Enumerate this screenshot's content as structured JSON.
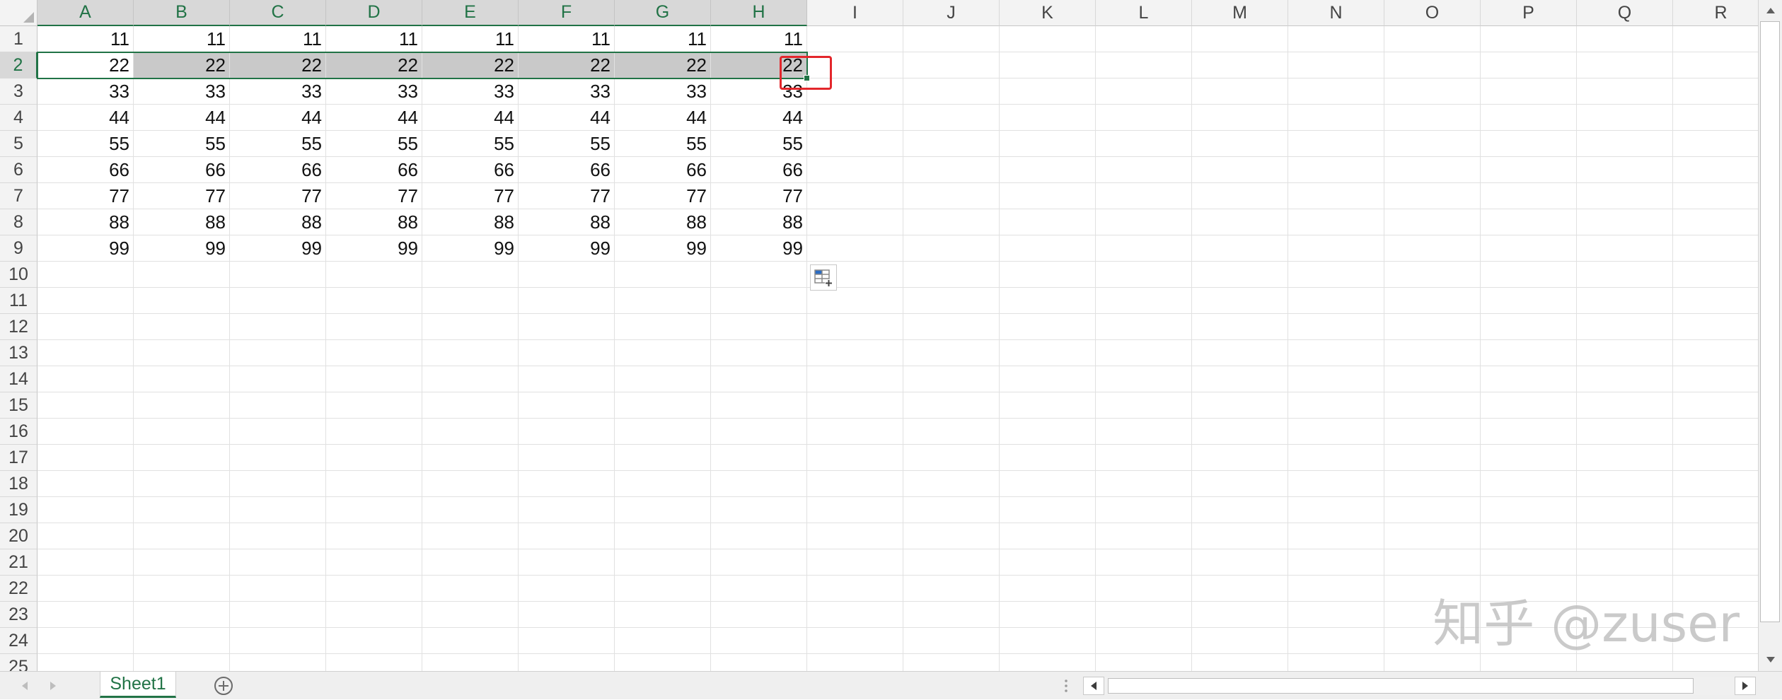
{
  "sheet": {
    "columns": [
      "A",
      "B",
      "C",
      "D",
      "E",
      "F",
      "G",
      "H",
      "I",
      "J",
      "K",
      "L",
      "M",
      "N",
      "O",
      "P",
      "Q",
      "R"
    ],
    "row_numbers": [
      "1",
      "2",
      "3",
      "4",
      "5",
      "6",
      "7",
      "8",
      "9",
      "10",
      "11",
      "12",
      "13",
      "14",
      "15",
      "16",
      "17",
      "18",
      "19",
      "20",
      "21",
      "22",
      "23",
      "24",
      "25"
    ],
    "cells": [
      [
        "11",
        "11",
        "11",
        "11",
        "11",
        "11",
        "11",
        "11"
      ],
      [
        "22",
        "22",
        "22",
        "22",
        "22",
        "22",
        "22",
        "22"
      ],
      [
        "33",
        "33",
        "33",
        "33",
        "33",
        "33",
        "33",
        "33"
      ],
      [
        "44",
        "44",
        "44",
        "44",
        "44",
        "44",
        "44",
        "44"
      ],
      [
        "55",
        "55",
        "55",
        "55",
        "55",
        "55",
        "55",
        "55"
      ],
      [
        "66",
        "66",
        "66",
        "66",
        "66",
        "66",
        "66",
        "66"
      ],
      [
        "77",
        "77",
        "77",
        "77",
        "77",
        "77",
        "77",
        "77"
      ],
      [
        "88",
        "88",
        "88",
        "88",
        "88",
        "88",
        "88",
        "88"
      ],
      [
        "99",
        "99",
        "99",
        "99",
        "99",
        "99",
        "99",
        "99"
      ]
    ],
    "selection": {
      "row": "2",
      "columns": [
        "A",
        "B",
        "C",
        "D",
        "E",
        "F",
        "G",
        "H"
      ],
      "active_column": "A"
    }
  },
  "sheet_tabs": {
    "tabs": [
      {
        "label": "Sheet1",
        "active": true
      }
    ]
  },
  "watermark": {
    "text": "知乎 @zuser"
  },
  "icons": {
    "select_all": "select-all-triangle-icon",
    "quick_analysis": "quick-analysis-icon",
    "tab_scroll_left": "triangle-left-icon",
    "tab_scroll_right": "triangle-right-icon",
    "add_sheet": "plus-circle-icon",
    "split_handle": "vertical-ellipsis-icon",
    "scroll_left": "triangle-left-icon",
    "scroll_right": "triangle-right-icon",
    "scroll_up": "triangle-up-icon",
    "scroll_down": "triangle-down-icon"
  },
  "colors": {
    "accent": "#217346",
    "annotation": "#e3262b",
    "selection_fill": "#c9c9c9",
    "header_bg": "#f3f3f3",
    "header_selected_bg": "#d8d8d8",
    "gridline": "#e1e1e1",
    "tab_bar_bg": "#efefef",
    "watermark": "#b9b9b9"
  }
}
